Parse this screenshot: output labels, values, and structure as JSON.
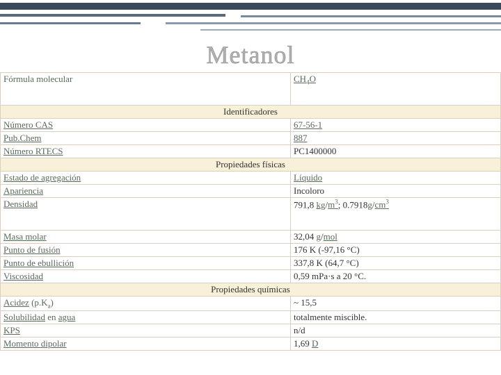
{
  "title": "Metanol",
  "top_row": {
    "label": "Fórmula molecular",
    "value_html": "CH<sub>4</sub>O"
  },
  "sections": [
    {
      "header": "Identificadores",
      "rows": [
        {
          "label": "Número CAS",
          "label_link": true,
          "value": "67-56-1",
          "value_link": true
        },
        {
          "label": "Pub.Chem",
          "label_link": true,
          "value": "887",
          "value_link": true
        },
        {
          "label": "Número RTECS",
          "label_link": true,
          "value": "PC1400000",
          "value_link": false
        }
      ]
    },
    {
      "header": "Propiedades físicas",
      "rows": [
        {
          "label": "Estado de agregación",
          "label_link": true,
          "value": "Líquido",
          "value_link": true
        },
        {
          "label": "Apariencia",
          "label_link": true,
          "value": "Incoloro",
          "value_link": false
        },
        {
          "label": "Densidad",
          "label_link": true,
          "value_html": "791,8 <a class='vlink'>kg</a>/<a class='vlink'>m<sup>3</sup></a>; 0.7918<a class='vlink'>g</a>/<a class='vlink'>cm<sup>3</sup></a>",
          "tall": true
        },
        {
          "label": "Masa molar",
          "label_link": true,
          "value_html": "32,04 <a class='vlink'>g</a>/<a class='vlink'>mol</a>"
        },
        {
          "label": "Punto de fusión",
          "label_link": true,
          "value": "176 K (-97,16 °C)",
          "value_link": false
        },
        {
          "label": "Punto de ebullición",
          "label_link": true,
          "value": "337,8 K (64,7 °C)",
          "value_link": false
        },
        {
          "label": "Viscosidad",
          "label_link": true,
          "value": "0,59 mPa·s a 20 °C.",
          "value_link": false
        }
      ]
    },
    {
      "header": "Propiedades químicas",
      "rows": [
        {
          "label_html": "<a class='ulink'>Acidez</a> (p.K<sub>a</sub>)",
          "value": "~ 15,5",
          "value_link": false
        },
        {
          "label_html": "<a class='ulink'>Solubilidad</a> en <a class='ulink'>agua</a>",
          "value": "totalmente miscible.",
          "value_link": false
        },
        {
          "label": "KPS",
          "label_link": true,
          "value": "n/d",
          "value_link": false
        },
        {
          "label": "Momento dipolar",
          "label_link": true,
          "value_html": "1,69 <a class='vlink'>D</a>"
        }
      ]
    }
  ]
}
